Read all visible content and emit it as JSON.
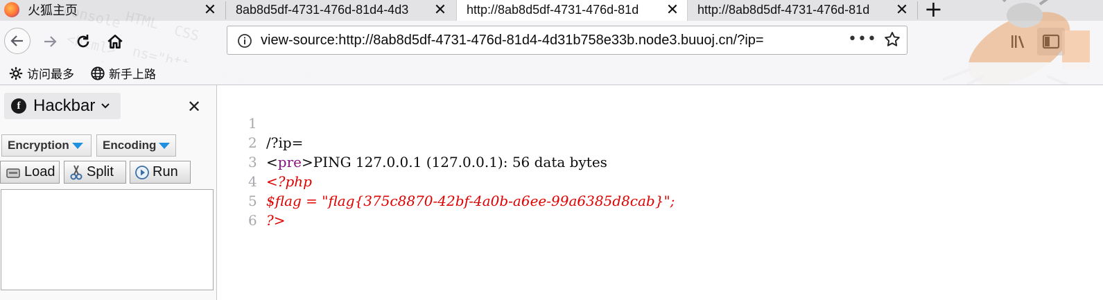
{
  "tabs": [
    {
      "label": "火狐主页",
      "active": false
    },
    {
      "label": "8ab8d5df-4731-476d-81d4-4d3",
      "active": false
    },
    {
      "label": "http://8ab8d5df-4731-476d-81d",
      "active": true
    },
    {
      "label": "http://8ab8d5df-4731-476d-81d",
      "active": false
    }
  ],
  "navbar": {
    "url": "view-source:http://8ab8d5df-4731-476d-81d4-4d31b758e33b.node3.buuoj.cn/?ip=",
    "page_actions": "•••"
  },
  "bookmarks": [
    {
      "label": "访问最多",
      "icon": "gear-icon"
    },
    {
      "label": "新手上路",
      "icon": "globe-icon"
    }
  ],
  "hackbar": {
    "title": "Hackbar",
    "dropdowns": [
      "Encryption",
      "Encoding"
    ],
    "buttons": {
      "load": "Load",
      "split": "Split",
      "run": "Run"
    },
    "textarea_value": ""
  },
  "source": {
    "line_numbers": [
      "1",
      "2",
      "3",
      "4",
      "5",
      "6"
    ],
    "line1": "/?ip=",
    "line2_open": "<",
    "line2_tag": "pre",
    "line2_close": ">",
    "line2_text": "PING 127.0.0.1 (127.0.0.1): 56 data bytes",
    "line3": "<?php",
    "line4": "$flag = \"flag{375c8870-42bf-4a0b-a6ee-99a6385d8cab}\";",
    "line5": "?>",
    "line6": ""
  },
  "colors": {
    "tag": "#881280",
    "php": "#e00000",
    "accent": "#1e90e0"
  }
}
